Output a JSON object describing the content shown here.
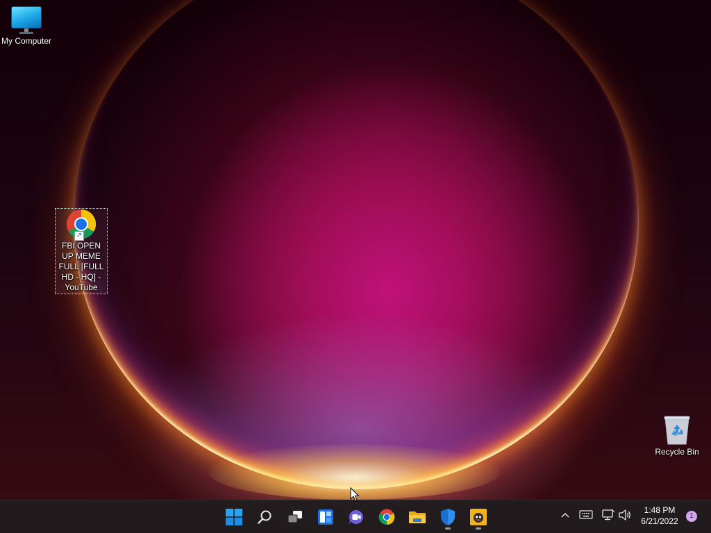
{
  "desktop": {
    "icons": {
      "my_computer": {
        "label": "My Computer",
        "icon": "monitor-icon"
      },
      "chrome_shortcut": {
        "label": "FBI OPEN UP MEME FULL [FULL HD - HQ] - YouTube",
        "icon": "chrome-icon",
        "selected": true
      },
      "recycle_bin": {
        "label": "Recycle Bin",
        "icon": "recycle-bin-icon"
      }
    }
  },
  "taskbar": {
    "apps": [
      {
        "name": "Start",
        "icon": "windows-logo-icon"
      },
      {
        "name": "Search",
        "icon": "search-icon"
      },
      {
        "name": "Task View",
        "icon": "task-view-icon"
      },
      {
        "name": "Widgets",
        "icon": "widgets-icon"
      },
      {
        "name": "Chat",
        "icon": "chat-icon"
      },
      {
        "name": "Google Chrome",
        "icon": "chrome-icon"
      },
      {
        "name": "File Explorer",
        "icon": "folder-icon"
      },
      {
        "name": "Windows Security",
        "icon": "shield-icon",
        "running": true
      },
      {
        "name": "App",
        "icon": "app-icon",
        "running": true
      }
    ],
    "tray": {
      "icons": [
        "chevron-up-icon",
        "keyboard-icon",
        "network-icon",
        "volume-icon"
      ],
      "time": "1:48 PM",
      "date": "6/21/2022",
      "notification_count": "1"
    }
  },
  "colors": {
    "taskbar": "#201c1e",
    "accent_blue": "#0078d4",
    "badge": "#d5a6f0"
  }
}
